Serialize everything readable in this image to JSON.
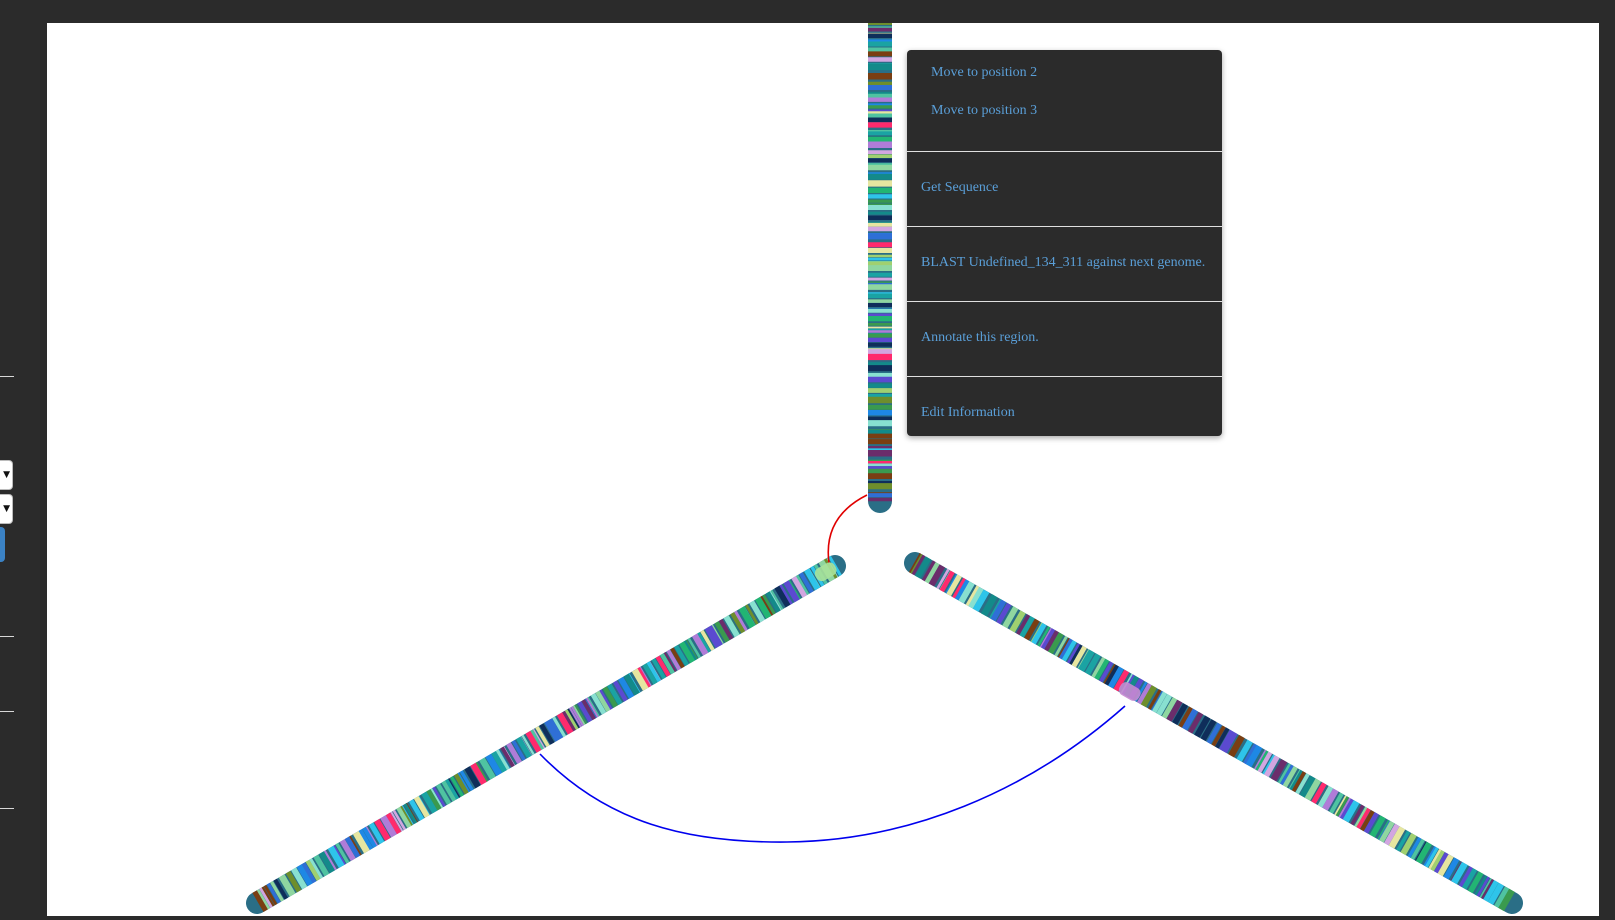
{
  "context_menu": {
    "move_items": [
      {
        "label": "Move to position 2"
      },
      {
        "label": "Move to position 3"
      }
    ],
    "get_sequence": "Get Sequence",
    "blast": "BLAST Undefined_134_311 against next genome.",
    "annotate": "Annotate this region.",
    "edit_info": "Edit Information"
  },
  "chromosomes": [
    {
      "name": "chromosome-vertical"
    },
    {
      "name": "chromosome-left-diagonal"
    },
    {
      "name": "chromosome-right-diagonal"
    }
  ],
  "links": [
    {
      "name": "link-red",
      "color": "#e00000"
    },
    {
      "name": "link-blue",
      "color": "#0000ee"
    }
  ],
  "stripe_palette": [
    "#2ec4ea",
    "#1aa3a3",
    "#8fd6a0",
    "#7a3e12",
    "#4fc3a1",
    "#2f6fd6",
    "#b07cd8",
    "#3a9a4e",
    "#0f2e5a",
    "#d2a6e0",
    "#6b2d6b",
    "#6e8e2c",
    "#22b573",
    "#ff2a6d",
    "#88e0d0",
    "#1e88e5",
    "#a0d070",
    "#e6e6a0",
    "#5b4ad0",
    "#138a8a"
  ]
}
